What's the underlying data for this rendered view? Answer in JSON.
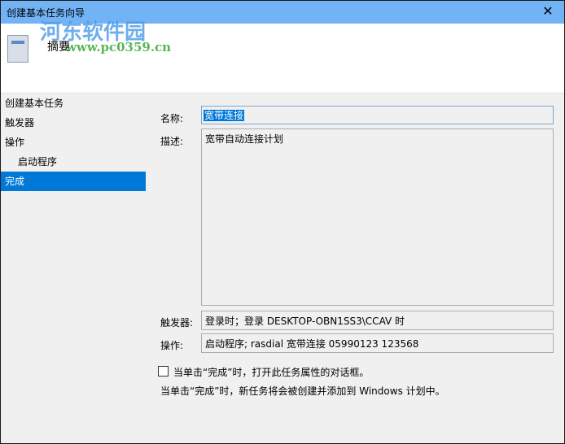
{
  "window": {
    "title": "创建基本任务向导",
    "close_icon": "close-icon"
  },
  "header": {
    "title": "摘要",
    "watermark_name": "河东软件园",
    "watermark_url": "www.pc0359.cn"
  },
  "sidebar": {
    "items": [
      {
        "label": "创建基本任务",
        "active": false
      },
      {
        "label": "触发器",
        "active": false
      },
      {
        "label": "操作",
        "active": false
      },
      {
        "label": "启动程序",
        "active": false,
        "sub": true
      },
      {
        "label": "完成",
        "active": true
      }
    ]
  },
  "form": {
    "name_label": "名称:",
    "name_value": "宽带连接",
    "desc_label": "描述:",
    "desc_value": "宽带自动连接计划",
    "trigger_label": "触发器:",
    "trigger_value": "登录时；登录 DESKTOP-OBN1SS3\\CCAV 时",
    "action_label": "操作:",
    "action_value": "启动程序; rasdial 宽带连接 05990123 123568",
    "checkbox_label": "当单击“完成”时，打开此任务属性的对话框。",
    "checkbox_checked": false,
    "note": "当单击“完成”时，新任务将会被创建并添加到 Windows 计划中。"
  }
}
